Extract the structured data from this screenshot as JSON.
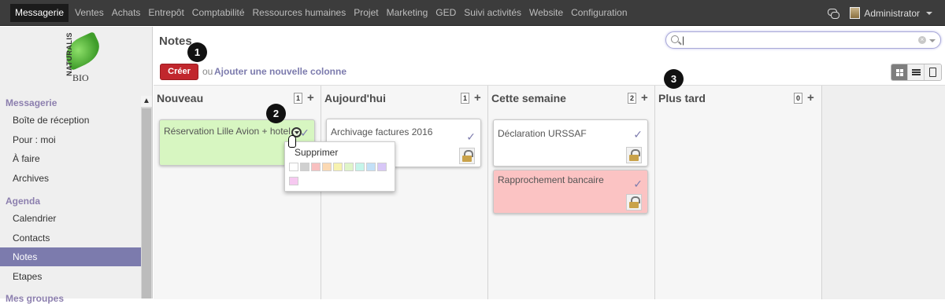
{
  "topbar": {
    "menu": [
      "Messagerie",
      "Ventes",
      "Achats",
      "Entrepôt",
      "Comptabilité",
      "Ressources humaines",
      "Projet",
      "Marketing",
      "GED",
      "Suivi activités",
      "Website",
      "Configuration"
    ],
    "active": "Messagerie",
    "user": "Administrator"
  },
  "logo": {
    "brand": "NATURALIS",
    "sub": "BIO"
  },
  "sidebar": {
    "section_messagerie": "Messagerie",
    "items_messagerie": [
      "Boîte de réception",
      "Pour : moi",
      "À faire",
      "Archives"
    ],
    "section_agenda": "Agenda",
    "items_agenda": [
      "Calendrier",
      "Contacts",
      "Notes",
      "Etapes"
    ],
    "section_groups": "Mes groupes",
    "active_item": "Notes"
  },
  "main": {
    "title": "Notes",
    "create_label": "Créer",
    "or_text": "ou",
    "add_column_label": "Ajouter une nouvelle colonne",
    "search_value": "|"
  },
  "columns": [
    {
      "name": "Nouveau",
      "count": "1"
    },
    {
      "name": "Aujourd'hui",
      "count": "1"
    },
    {
      "name": "Cette semaine",
      "count": "2"
    },
    {
      "name": "Plus tard",
      "count": "0"
    }
  ],
  "cards": {
    "c1": {
      "title": "Réservation Lille Avion + hotel",
      "color": "#d7f6c1"
    },
    "c2": {
      "title": "Archivage factures 2016",
      "color": "#ffffff"
    },
    "c3": {
      "title": "Déclaration URSSAF",
      "color": "#ffffff"
    },
    "c4": {
      "title": "Rapprochement bancaire",
      "color": "#fbc3c3"
    }
  },
  "popup": {
    "delete_label": "Supprimer",
    "swatches": [
      "#ffffff",
      "#d0d0d0",
      "#f8c0c0",
      "#fbd9b3",
      "#f7f2b0",
      "#dff5c8",
      "#c5f5ea",
      "#c3e0f7",
      "#c9d0fa",
      "#d8c7f7",
      "#f6c8f0"
    ]
  },
  "markers": [
    "1",
    "2",
    "3"
  ],
  "icons": [
    "chat-icon",
    "avatar",
    "search-icon",
    "clear-icon",
    "kanban-view-icon",
    "list-view-icon",
    "form-view-icon",
    "check-icon",
    "lock-icon",
    "gear-icon"
  ]
}
